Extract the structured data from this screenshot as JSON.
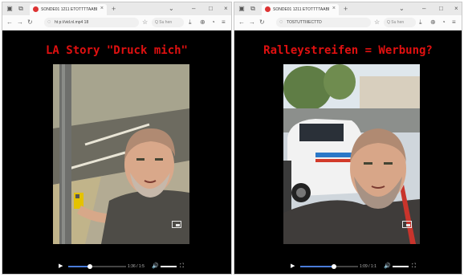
{
  "windows": [
    {
      "tab_title": "SONDE01 1211 ETOTTTTAABBIT",
      "url": "ht p://vid.nl.mp4 18",
      "search_placeholder": "Q Su hen",
      "heading": "LA Story \"Druck mich\"",
      "video": {
        "time": "1:36 / 1:5",
        "progress": 0.38,
        "scene": "man pressing yellow pedestrian crossing button next to a traffic light pole on a sidewalk"
      }
    },
    {
      "tab_title": "SONDE01 1211 ETOTTTTAABBIT",
      "url": "TOSTUTTIIIECTTD",
      "search_placeholder": "Q Su hen",
      "heading": "Ralleystreifen = Werbung?",
      "video": {
        "time": "1:09 / 1:1",
        "progress": 0.58,
        "scene": "selfie of a bald bearded man in a dark shirt in front of a white car with blue stripes on a street"
      }
    }
  ],
  "icons": {
    "back": "arrow-left-icon",
    "forward": "arrow-right-icon",
    "reload": "reload-icon",
    "home": "home-icon",
    "play": "play-icon",
    "volume": "volume-icon",
    "fullscreen": "fullscreen-icon",
    "pip": "picture-in-picture-icon"
  },
  "colors": {
    "heading": "#e01010",
    "page_background": "#000000",
    "progress": "#4a7cd8"
  }
}
